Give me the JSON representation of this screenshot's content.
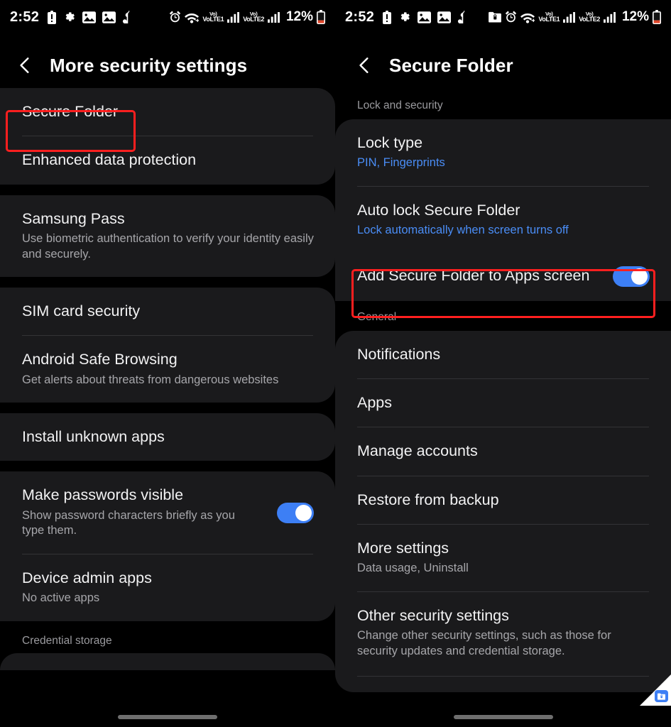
{
  "left_screen": {
    "status_bar": {
      "time": "2:52",
      "left_icons": [
        "battery-alert-icon",
        "gear-icon",
        "image-icon",
        "image-icon",
        "music-note-icon"
      ],
      "right_icons": [
        "alarm-icon",
        "wifi-icon",
        "volte1-icon",
        "signal-bars-icon",
        "volte2-icon",
        "signal-bars-icon"
      ],
      "volte1_label": "VoLTE1",
      "volte2_label": "VoLTE2",
      "battery_percent": "12%"
    },
    "header": {
      "title": "More security settings",
      "back": "back-arrow"
    },
    "cards": [
      {
        "rows": [
          {
            "title": "Secure Folder",
            "sub": "",
            "highlighted": true
          },
          {
            "title": "Enhanced data protection",
            "sub": ""
          }
        ]
      },
      {
        "rows": [
          {
            "title": "Samsung Pass",
            "sub": "Use biometric authentication to verify your identity easily and securely."
          }
        ]
      },
      {
        "rows": [
          {
            "title": "SIM card security",
            "sub": ""
          },
          {
            "title": "Android Safe Browsing",
            "sub": "Get alerts about threats from dangerous websites"
          }
        ]
      },
      {
        "rows": [
          {
            "title": "Install unknown apps",
            "sub": ""
          }
        ]
      },
      {
        "rows": [
          {
            "title": "Make passwords visible",
            "sub": "Show password characters briefly as you type them.",
            "toggle": true,
            "toggle_on": true
          },
          {
            "title": "Device admin apps",
            "sub": "No active apps"
          }
        ]
      }
    ],
    "trailing_section_label": "Credential storage"
  },
  "right_screen": {
    "status_bar": {
      "time": "2:52",
      "left_icons": [
        "battery-alert-icon",
        "gear-icon",
        "image-icon",
        "image-icon",
        "music-note-icon"
      ],
      "right_icons": [
        "secure-folder-icon",
        "alarm-icon",
        "wifi-icon",
        "volte1-icon",
        "signal-bars-icon",
        "volte2-icon",
        "signal-bars-icon"
      ],
      "volte1_label": "VoLTE1",
      "volte2_label": "VoLTE2",
      "battery_percent": "12%"
    },
    "header": {
      "title": "Secure Folder",
      "back": "back-arrow"
    },
    "section_lock": "Lock and security",
    "lock_card": {
      "rows": [
        {
          "title": "Lock type",
          "sub": "PIN, Fingerprints",
          "sub_blue": true
        },
        {
          "title": "Auto lock Secure Folder",
          "sub": "Lock automatically when screen turns off",
          "sub_blue": true
        }
      ]
    },
    "apps_screen_row": {
      "title": "Add Secure Folder to Apps screen",
      "toggle_on": true,
      "highlighted": true
    },
    "section_general": "General",
    "general_card": {
      "rows": [
        {
          "title": "Notifications",
          "sub": ""
        },
        {
          "title": "Apps",
          "sub": ""
        },
        {
          "title": "Manage accounts",
          "sub": ""
        },
        {
          "title": "Restore from backup",
          "sub": ""
        },
        {
          "title": "More settings",
          "sub": "Data usage, Uninstall"
        },
        {
          "title": "Other security settings",
          "sub": "Change other security settings, such as those for security updates and credential storage."
        }
      ]
    }
  },
  "colors": {
    "background": "#000000",
    "card": "#1a1a1c",
    "accent_blue": "#3d7ff5",
    "link_blue": "#4a8df6",
    "highlight_red": "#ff1f1f",
    "title_text": "#f2f2f3",
    "sub_text": "#a6a6aa",
    "section_text": "#9a9a9e"
  }
}
